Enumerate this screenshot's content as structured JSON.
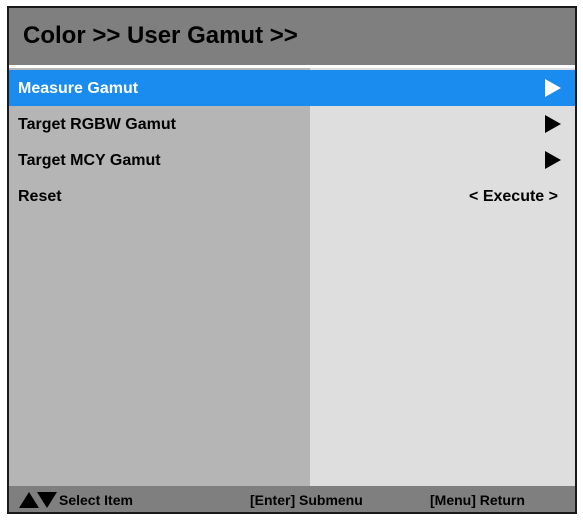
{
  "title": "Color >> User Gamut >>",
  "menu": {
    "items": [
      {
        "label": "Measure Gamut",
        "value": "",
        "selected": true,
        "has_submenu": true
      },
      {
        "label": "Target RGBW Gamut",
        "value": "",
        "selected": false,
        "has_submenu": true
      },
      {
        "label": "Target MCY Gamut",
        "value": "",
        "selected": false,
        "has_submenu": true
      },
      {
        "label": "Reset",
        "value": "< Execute >",
        "selected": false,
        "has_submenu": false
      }
    ]
  },
  "footer": {
    "select": "Select Item",
    "enter": "[Enter] Submenu",
    "return": "[Menu] Return"
  },
  "colors": {
    "title_bar": "#7f7f7f",
    "selection": "#1a8cf0",
    "left_pane": "#b5b5b5",
    "right_pane": "#dedede"
  },
  "icons": {
    "submenu": "triangle-right-icon",
    "nav": "up-down-triangle-icon"
  }
}
